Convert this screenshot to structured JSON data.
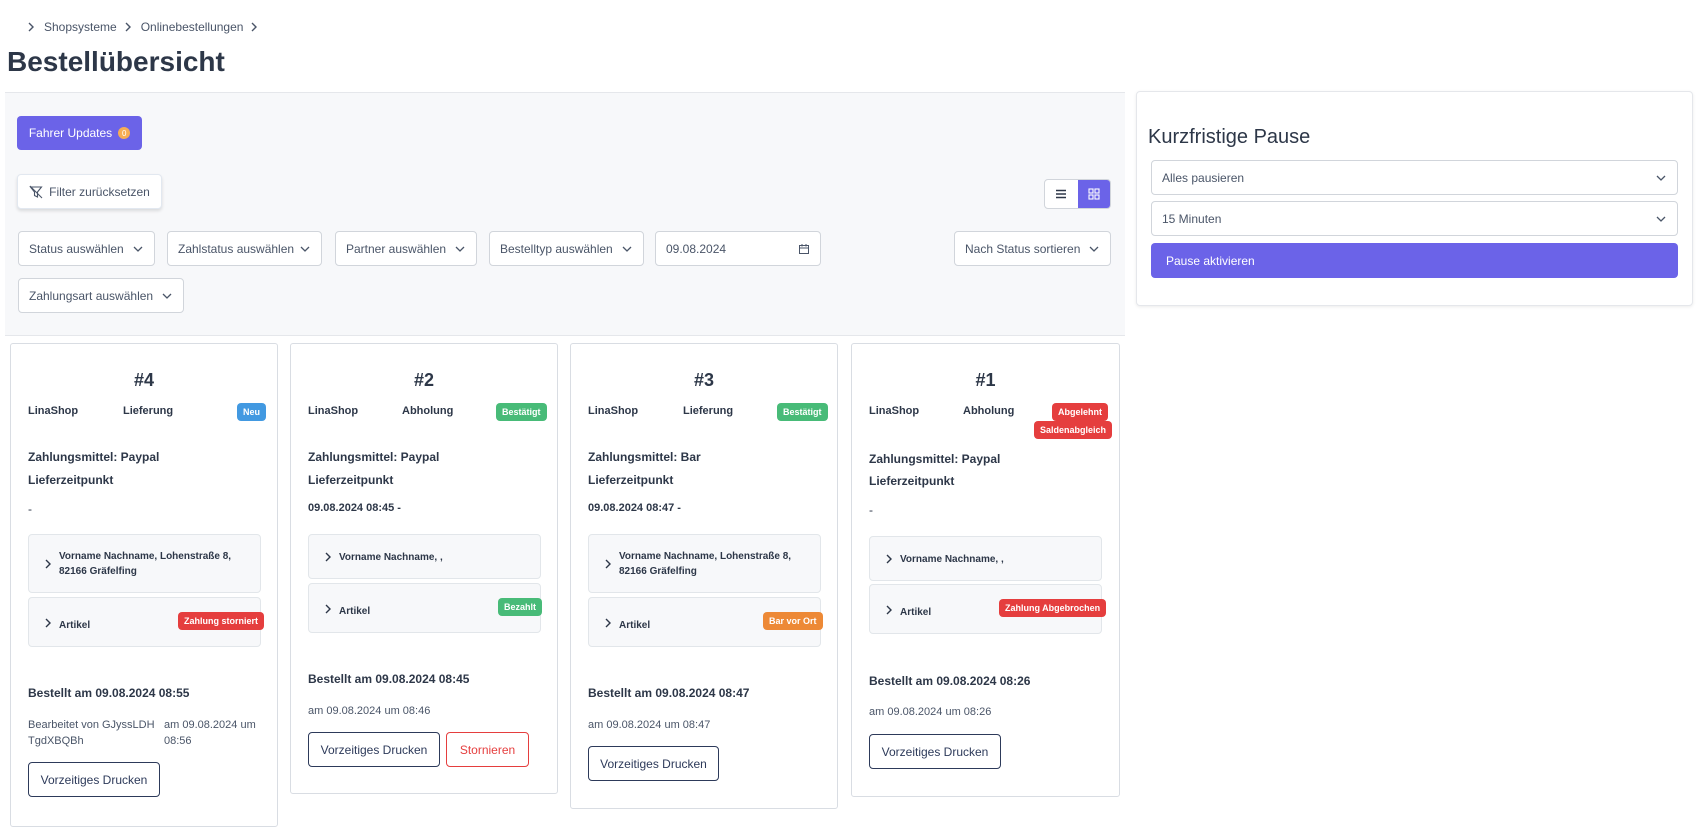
{
  "breadcrumb": [
    "Shopsysteme",
    "Onlinebestellungen"
  ],
  "page_title": "Bestellübersicht",
  "toolbar": {
    "driver_updates_label": "Fahrer Updates",
    "driver_updates_count": "0",
    "reset_filter_label": "Filter zurücksetzen"
  },
  "filters": {
    "status": "Status auswählen",
    "payment_status": "Zahlstatus auswählen",
    "partner": "Partner auswählen",
    "order_type": "Bestelltyp auswählen",
    "date": "09.08.2024",
    "sort": "Nach Status sortieren",
    "payment_method": "Zahlungsart auswählen"
  },
  "pause": {
    "title": "Kurzfristige Pause",
    "scope": "Alles pausieren",
    "duration": "15 Minuten",
    "activate_label": "Pause aktivieren"
  },
  "common": {
    "delivery_time_label": "Lieferzeitpunkt",
    "items_label": "Artikel",
    "print_label": "Vorzeitiges Drucken",
    "cancel_label": "Stornieren"
  },
  "orders": [
    {
      "number": "#4",
      "shop": "LinaShop",
      "type": "Lieferung",
      "status": "Neu",
      "payment": "Zahlungsmittel: Paypal",
      "delivery_time": "-",
      "address_line1": "Vorname Nachname, Lohenstraße 8,",
      "address_line2": "82166 Gräfelfing",
      "payment_badge": "Zahlung storniert",
      "ordered": "Bestellt am 09.08.2024 08:55",
      "edited_by_line1": "Bearbeitet von GJyssLDH",
      "edited_by_line2": "TgdXBQBh",
      "edited_at_line1": "am 09.08.2024 um",
      "edited_at_line2": "08:56"
    },
    {
      "number": "#2",
      "shop": "LinaShop",
      "type": "Abholung",
      "status": "Bestätigt",
      "payment": "Zahlungsmittel: Paypal",
      "delivery_time": "09.08.2024 08:45 -",
      "address_line1": "Vorname Nachname, ,",
      "payment_badge": "Bezahlt",
      "ordered": "Bestellt am 09.08.2024 08:45",
      "edited_at": "am 09.08.2024 um 08:46"
    },
    {
      "number": "#3",
      "shop": "LinaShop",
      "type": "Lieferung",
      "status": "Bestätigt",
      "payment": "Zahlungsmittel: Bar",
      "delivery_time": "09.08.2024 08:47 -",
      "address_line1": "Vorname Nachname, Lohenstraße 8,",
      "address_line2": "82166 Gräfelfing",
      "payment_badge": "Bar vor Ort",
      "ordered": "Bestellt am 09.08.2024 08:47",
      "edited_at": "am 09.08.2024 um 08:47"
    },
    {
      "number": "#1",
      "shop": "LinaShop",
      "type": "Abholung",
      "status": "Abgelehnt",
      "status2": "Saldenabgleich",
      "payment": "Zahlungsmittel: Paypal",
      "delivery_time": "-",
      "address_line1": "Vorname Nachname, ,",
      "payment_badge": "Zahlung Abgebrochen",
      "ordered": "Bestellt am 09.08.2024 08:26",
      "edited_at": "am 09.08.2024 um 08:26"
    }
  ]
}
